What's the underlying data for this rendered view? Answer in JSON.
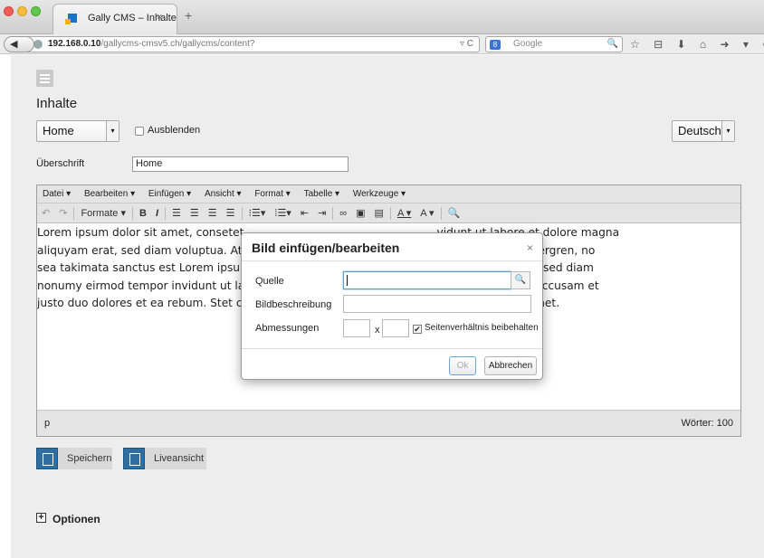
{
  "browser": {
    "tab_title": "Gally CMS – Inhalte",
    "tab_close": "×",
    "new_tab": "+",
    "url_host": "192.168.0.10",
    "url_path": "/gallycms-cmsv5.ch/gallycms/content?",
    "search_placeholder": "Google",
    "toolbar_icons": "☆ ⊟ ⬇ ⌂ ➜ ▾ ⊕ ≡"
  },
  "page": {
    "title": "Inhalte",
    "page_select_value": "Home",
    "hide_checkbox_label": "Ausblenden",
    "language_select_value": "Deutsch",
    "heading_label": "Überschrift",
    "heading_value": "Home"
  },
  "editor": {
    "menus": [
      "Datei ▾",
      "Bearbeiten ▾",
      "Einfügen ▾",
      "Ansicht ▾",
      "Format ▾",
      "Tabelle ▾",
      "Werkzeuge ▾"
    ],
    "formats_label": "Formate ▾",
    "content_lines": [
      "Lorem ipsum dolor sit amet, consetet                                                       vidunt ut labore et dolore magna",
      "aliquyam erat, sed diam voluptua. At                                                       Stet clita kasd gubergren, no",
      "sea takimata sanctus est Lorem ipsur                                                       ur sadipscing elitr, sed diam",
      "nonumy eirmod tempor invidunt ut la                                                        a. At vero eos et accusam et",
      "justo duo dolores et ea rebum. Stet c                                                      n ipsum dolor sit amet."
    ],
    "status_path": "p",
    "word_count": "Wörter: 100"
  },
  "actions": {
    "save_label": "Speichern",
    "preview_label": "Liveansicht",
    "options_label": "Optionen",
    "options_toggle": "+"
  },
  "dialog": {
    "title": "Bild einfügen/bearbeiten",
    "close": "×",
    "source_label": "Quelle",
    "description_label": "Bildbeschreibung",
    "dimensions_label": "Abmessungen",
    "dimensions_separator": "x",
    "keep_ratio_label": "Seitenverhältnis beibehalten",
    "ok_label": "Ok",
    "cancel_label": "Abbrechen"
  }
}
